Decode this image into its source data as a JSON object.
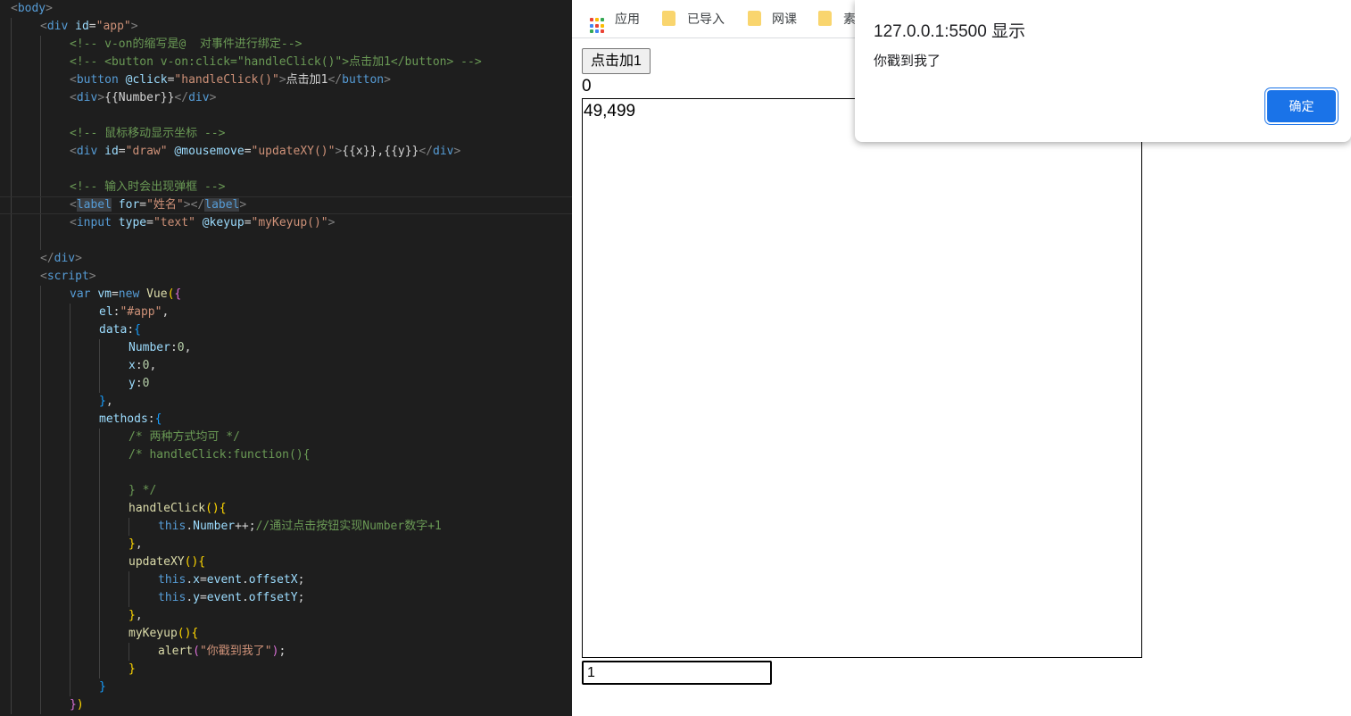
{
  "editor": {
    "lines": [
      {
        "indent": 0,
        "tokens": [
          [
            "<",
            "punct"
          ],
          [
            "body",
            "tag"
          ],
          [
            ">",
            "punct"
          ]
        ]
      },
      {
        "indent": 1,
        "tokens": [
          [
            "<",
            "punct"
          ],
          [
            "div",
            "tag"
          ],
          [
            " ",
            "text"
          ],
          [
            "id",
            "attr"
          ],
          [
            "=",
            "text"
          ],
          [
            "\"app\"",
            "str"
          ],
          [
            ">",
            "punct"
          ]
        ]
      },
      {
        "indent": 2,
        "tokens": [
          [
            "<!-- v-on的缩写是@  对事件进行绑定-->",
            "cmt"
          ]
        ]
      },
      {
        "indent": 2,
        "tokens": [
          [
            "<!-- <button v-on:click=\"handleClick()\">点击加1</button> -->",
            "cmt"
          ]
        ]
      },
      {
        "indent": 2,
        "tokens": [
          [
            "<",
            "punct"
          ],
          [
            "button",
            "tag"
          ],
          [
            " ",
            "text"
          ],
          [
            "@click",
            "attr"
          ],
          [
            "=",
            "text"
          ],
          [
            "\"handleClick()\"",
            "str"
          ],
          [
            ">",
            "punct"
          ],
          [
            "点击加1",
            "text"
          ],
          [
            "</",
            "punct"
          ],
          [
            "button",
            "tag"
          ],
          [
            ">",
            "punct"
          ]
        ]
      },
      {
        "indent": 2,
        "tokens": [
          [
            "<",
            "punct"
          ],
          [
            "div",
            "tag"
          ],
          [
            ">",
            "punct"
          ],
          [
            "{{Number}}",
            "text"
          ],
          [
            "</",
            "punct"
          ],
          [
            "div",
            "tag"
          ],
          [
            ">",
            "punct"
          ]
        ]
      },
      {
        "indent": 2,
        "tokens": []
      },
      {
        "indent": 2,
        "tokens": [
          [
            "<!-- 鼠标移动显示坐标 -->",
            "cmt"
          ]
        ]
      },
      {
        "indent": 2,
        "tokens": [
          [
            "<",
            "punct"
          ],
          [
            "div",
            "tag"
          ],
          [
            " ",
            "text"
          ],
          [
            "id",
            "attr"
          ],
          [
            "=",
            "text"
          ],
          [
            "\"draw\"",
            "str"
          ],
          [
            " ",
            "text"
          ],
          [
            "@mousemove",
            "attr"
          ],
          [
            "=",
            "text"
          ],
          [
            "\"updateXY()\"",
            "str"
          ],
          [
            ">",
            "punct"
          ],
          [
            "{{x}},{{y}}",
            "text"
          ],
          [
            "</",
            "punct"
          ],
          [
            "div",
            "tag"
          ],
          [
            ">",
            "punct"
          ]
        ]
      },
      {
        "indent": 2,
        "tokens": []
      },
      {
        "indent": 2,
        "tokens": [
          [
            "<!-- 输入时会出现弹框 -->",
            "cmt"
          ]
        ]
      },
      {
        "indent": 2,
        "highlight": true,
        "tokens": [
          [
            "<",
            "punct"
          ],
          [
            "label",
            "sel"
          ],
          [
            " ",
            "text"
          ],
          [
            "for",
            "attr"
          ],
          [
            "=",
            "text"
          ],
          [
            "\"姓名\"",
            "str"
          ],
          [
            "></",
            "punct"
          ],
          [
            "label",
            "sel"
          ],
          [
            ">",
            "punct"
          ]
        ]
      },
      {
        "indent": 2,
        "tokens": [
          [
            "<",
            "punct"
          ],
          [
            "input",
            "tag"
          ],
          [
            " ",
            "text"
          ],
          [
            "type",
            "attr"
          ],
          [
            "=",
            "text"
          ],
          [
            "\"text\"",
            "str"
          ],
          [
            " ",
            "text"
          ],
          [
            "@keyup",
            "attr"
          ],
          [
            "=",
            "text"
          ],
          [
            "\"myKeyup()\"",
            "str"
          ],
          [
            ">",
            "punct"
          ]
        ]
      },
      {
        "indent": 2,
        "tokens": []
      },
      {
        "indent": 1,
        "tokens": [
          [
            "</",
            "punct"
          ],
          [
            "div",
            "tag"
          ],
          [
            ">",
            "punct"
          ]
        ]
      },
      {
        "indent": 1,
        "tokens": [
          [
            "<",
            "punct"
          ],
          [
            "script",
            "tag"
          ],
          [
            ">",
            "punct"
          ]
        ]
      },
      {
        "indent": 2,
        "tokens": [
          [
            "var",
            "kw"
          ],
          [
            " ",
            "text"
          ],
          [
            "vm",
            "prop"
          ],
          [
            "=",
            "text"
          ],
          [
            "new",
            "kw"
          ],
          [
            " ",
            "text"
          ],
          [
            "Vue",
            "fn"
          ],
          [
            "(",
            "br1"
          ],
          [
            "{",
            "br2"
          ]
        ]
      },
      {
        "indent": 3,
        "tokens": [
          [
            "el",
            "prop"
          ],
          [
            ":",
            "text"
          ],
          [
            "\"#app\"",
            "str"
          ],
          [
            ",",
            "text"
          ]
        ]
      },
      {
        "indent": 3,
        "tokens": [
          [
            "data",
            "prop"
          ],
          [
            ":",
            "text"
          ],
          [
            "{",
            "br3"
          ]
        ]
      },
      {
        "indent": 4,
        "tokens": [
          [
            "Number",
            "prop"
          ],
          [
            ":",
            "text"
          ],
          [
            "0",
            "num"
          ],
          [
            ",",
            "text"
          ]
        ]
      },
      {
        "indent": 4,
        "tokens": [
          [
            "x",
            "prop"
          ],
          [
            ":",
            "text"
          ],
          [
            "0",
            "num"
          ],
          [
            ",",
            "text"
          ]
        ]
      },
      {
        "indent": 4,
        "tokens": [
          [
            "y",
            "prop"
          ],
          [
            ":",
            "text"
          ],
          [
            "0",
            "num"
          ]
        ]
      },
      {
        "indent": 3,
        "tokens": [
          [
            "}",
            "br3"
          ],
          [
            ",",
            "text"
          ]
        ]
      },
      {
        "indent": 3,
        "tokens": [
          [
            "methods",
            "prop"
          ],
          [
            ":",
            "text"
          ],
          [
            "{",
            "br3"
          ]
        ]
      },
      {
        "indent": 4,
        "tokens": [
          [
            "/* 两种方式均可 */",
            "cmt"
          ]
        ]
      },
      {
        "indent": 4,
        "tokens": [
          [
            "/* handleClick:function(){",
            "cmt"
          ]
        ]
      },
      {
        "indent": 4,
        "tokens": []
      },
      {
        "indent": 4,
        "tokens": [
          [
            "} */",
            "cmt"
          ]
        ]
      },
      {
        "indent": 4,
        "tokens": [
          [
            "handleClick",
            "fn"
          ],
          [
            "()",
            "br1"
          ],
          [
            "{",
            "br1"
          ]
        ]
      },
      {
        "indent": 5,
        "tokens": [
          [
            "this",
            "kw"
          ],
          [
            ".",
            "text"
          ],
          [
            "Number",
            "prop"
          ],
          [
            "++;",
            "text"
          ],
          [
            "//通过点击按钮实现Number数字+1",
            "cmt"
          ]
        ]
      },
      {
        "indent": 4,
        "tokens": [
          [
            "}",
            "br1"
          ],
          [
            ",",
            "text"
          ]
        ]
      },
      {
        "indent": 4,
        "tokens": [
          [
            "updateXY",
            "fn"
          ],
          [
            "()",
            "br1"
          ],
          [
            "{",
            "br1"
          ]
        ]
      },
      {
        "indent": 5,
        "tokens": [
          [
            "this",
            "kw"
          ],
          [
            ".",
            "text"
          ],
          [
            "x",
            "prop"
          ],
          [
            "=",
            "text"
          ],
          [
            "event",
            "prop"
          ],
          [
            ".",
            "text"
          ],
          [
            "offsetX",
            "prop"
          ],
          [
            ";",
            "text"
          ]
        ]
      },
      {
        "indent": 5,
        "tokens": [
          [
            "this",
            "kw"
          ],
          [
            ".",
            "text"
          ],
          [
            "y",
            "prop"
          ],
          [
            "=",
            "text"
          ],
          [
            "event",
            "prop"
          ],
          [
            ".",
            "text"
          ],
          [
            "offsetY",
            "prop"
          ],
          [
            ";",
            "text"
          ]
        ]
      },
      {
        "indent": 4,
        "tokens": [
          [
            "}",
            "br1"
          ],
          [
            ",",
            "text"
          ]
        ]
      },
      {
        "indent": 4,
        "tokens": [
          [
            "myKeyup",
            "fn"
          ],
          [
            "()",
            "br1"
          ],
          [
            "{",
            "br1"
          ]
        ]
      },
      {
        "indent": 5,
        "tokens": [
          [
            "alert",
            "fn"
          ],
          [
            "(",
            "br2"
          ],
          [
            "\"你戳到我了\"",
            "str"
          ],
          [
            ")",
            "br2"
          ],
          [
            ";",
            "text"
          ]
        ]
      },
      {
        "indent": 4,
        "tokens": [
          [
            "}",
            "br1"
          ]
        ]
      },
      {
        "indent": 3,
        "tokens": [
          [
            "}",
            "br3"
          ]
        ]
      },
      {
        "indent": 2,
        "tokens": [
          [
            "}",
            "br2"
          ],
          [
            ")",
            "br1"
          ]
        ]
      }
    ]
  },
  "bookmarks": {
    "apps_label": "应用",
    "apps_icon": "apps-grid-icon",
    "folder_icon": "folder-icon",
    "folders": [
      "已导入",
      "网课",
      "素"
    ]
  },
  "page": {
    "button_label": "点击加1",
    "number_value": "0",
    "coords_text": "49,499",
    "input_value": "1"
  },
  "alert": {
    "title": "127.0.0.1:5500 显示",
    "message": "你戳到我了",
    "ok_label": "确定"
  },
  "colors": {
    "editor_bg": "#1e1e1e",
    "accent": "#1a73e8",
    "folder": "#f9d56e"
  }
}
